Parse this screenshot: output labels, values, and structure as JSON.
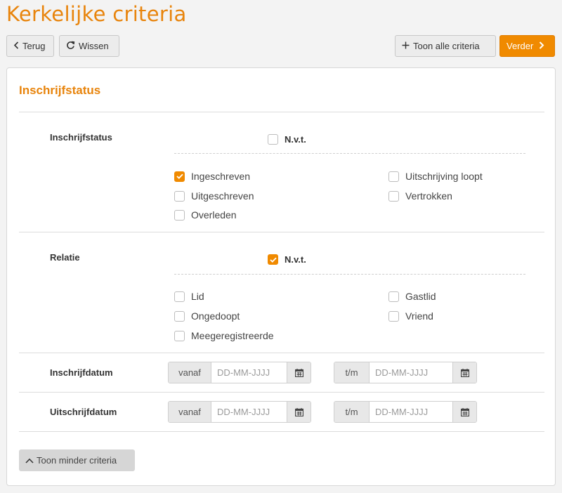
{
  "page": {
    "title": "Kerkelijke criteria"
  },
  "toolbar": {
    "back_label": "Terug",
    "clear_label": "Wissen",
    "show_all_label": "Toon alle criteria",
    "next_label": "Verder"
  },
  "section": {
    "title": "Inschrijfstatus"
  },
  "inschrijfstatus": {
    "label": "Inschrijfstatus",
    "nvt": {
      "label": "N.v.t.",
      "checked": false
    },
    "options": [
      {
        "label": "Ingeschreven",
        "checked": true
      },
      {
        "label": "Uitschrijving loopt",
        "checked": false
      },
      {
        "label": "Uitgeschreven",
        "checked": false
      },
      {
        "label": "Vertrokken",
        "checked": false
      },
      {
        "label": "Overleden",
        "checked": false
      }
    ]
  },
  "relatie": {
    "label": "Relatie",
    "nvt": {
      "label": "N.v.t.",
      "checked": true
    },
    "options": [
      {
        "label": "Lid",
        "checked": false
      },
      {
        "label": "Gastlid",
        "checked": false
      },
      {
        "label": "Ongedoopt",
        "checked": false
      },
      {
        "label": "Vriend",
        "checked": false
      },
      {
        "label": "Meegeregistreerde",
        "checked": false
      }
    ]
  },
  "inschrijfdatum": {
    "label": "Inschrijfdatum",
    "from_addon": "vanaf",
    "to_addon": "t/m",
    "placeholder": "DD-MM-JJJJ"
  },
  "uitschrijfdatum": {
    "label": "Uitschrijfdatum",
    "from_addon": "vanaf",
    "to_addon": "t/m",
    "placeholder": "DD-MM-JJJJ"
  },
  "footer": {
    "toggle_label": "Toon minder criteria"
  },
  "colors": {
    "accent": "#f08a00",
    "title": "#e8840c"
  },
  "icons": {
    "back": "chevron-left-icon",
    "clear": "refresh-icon",
    "show_all": "plus-icon",
    "next": "chevron-right-icon",
    "calendar": "calendar-icon",
    "toggle": "chevron-up-icon"
  }
}
